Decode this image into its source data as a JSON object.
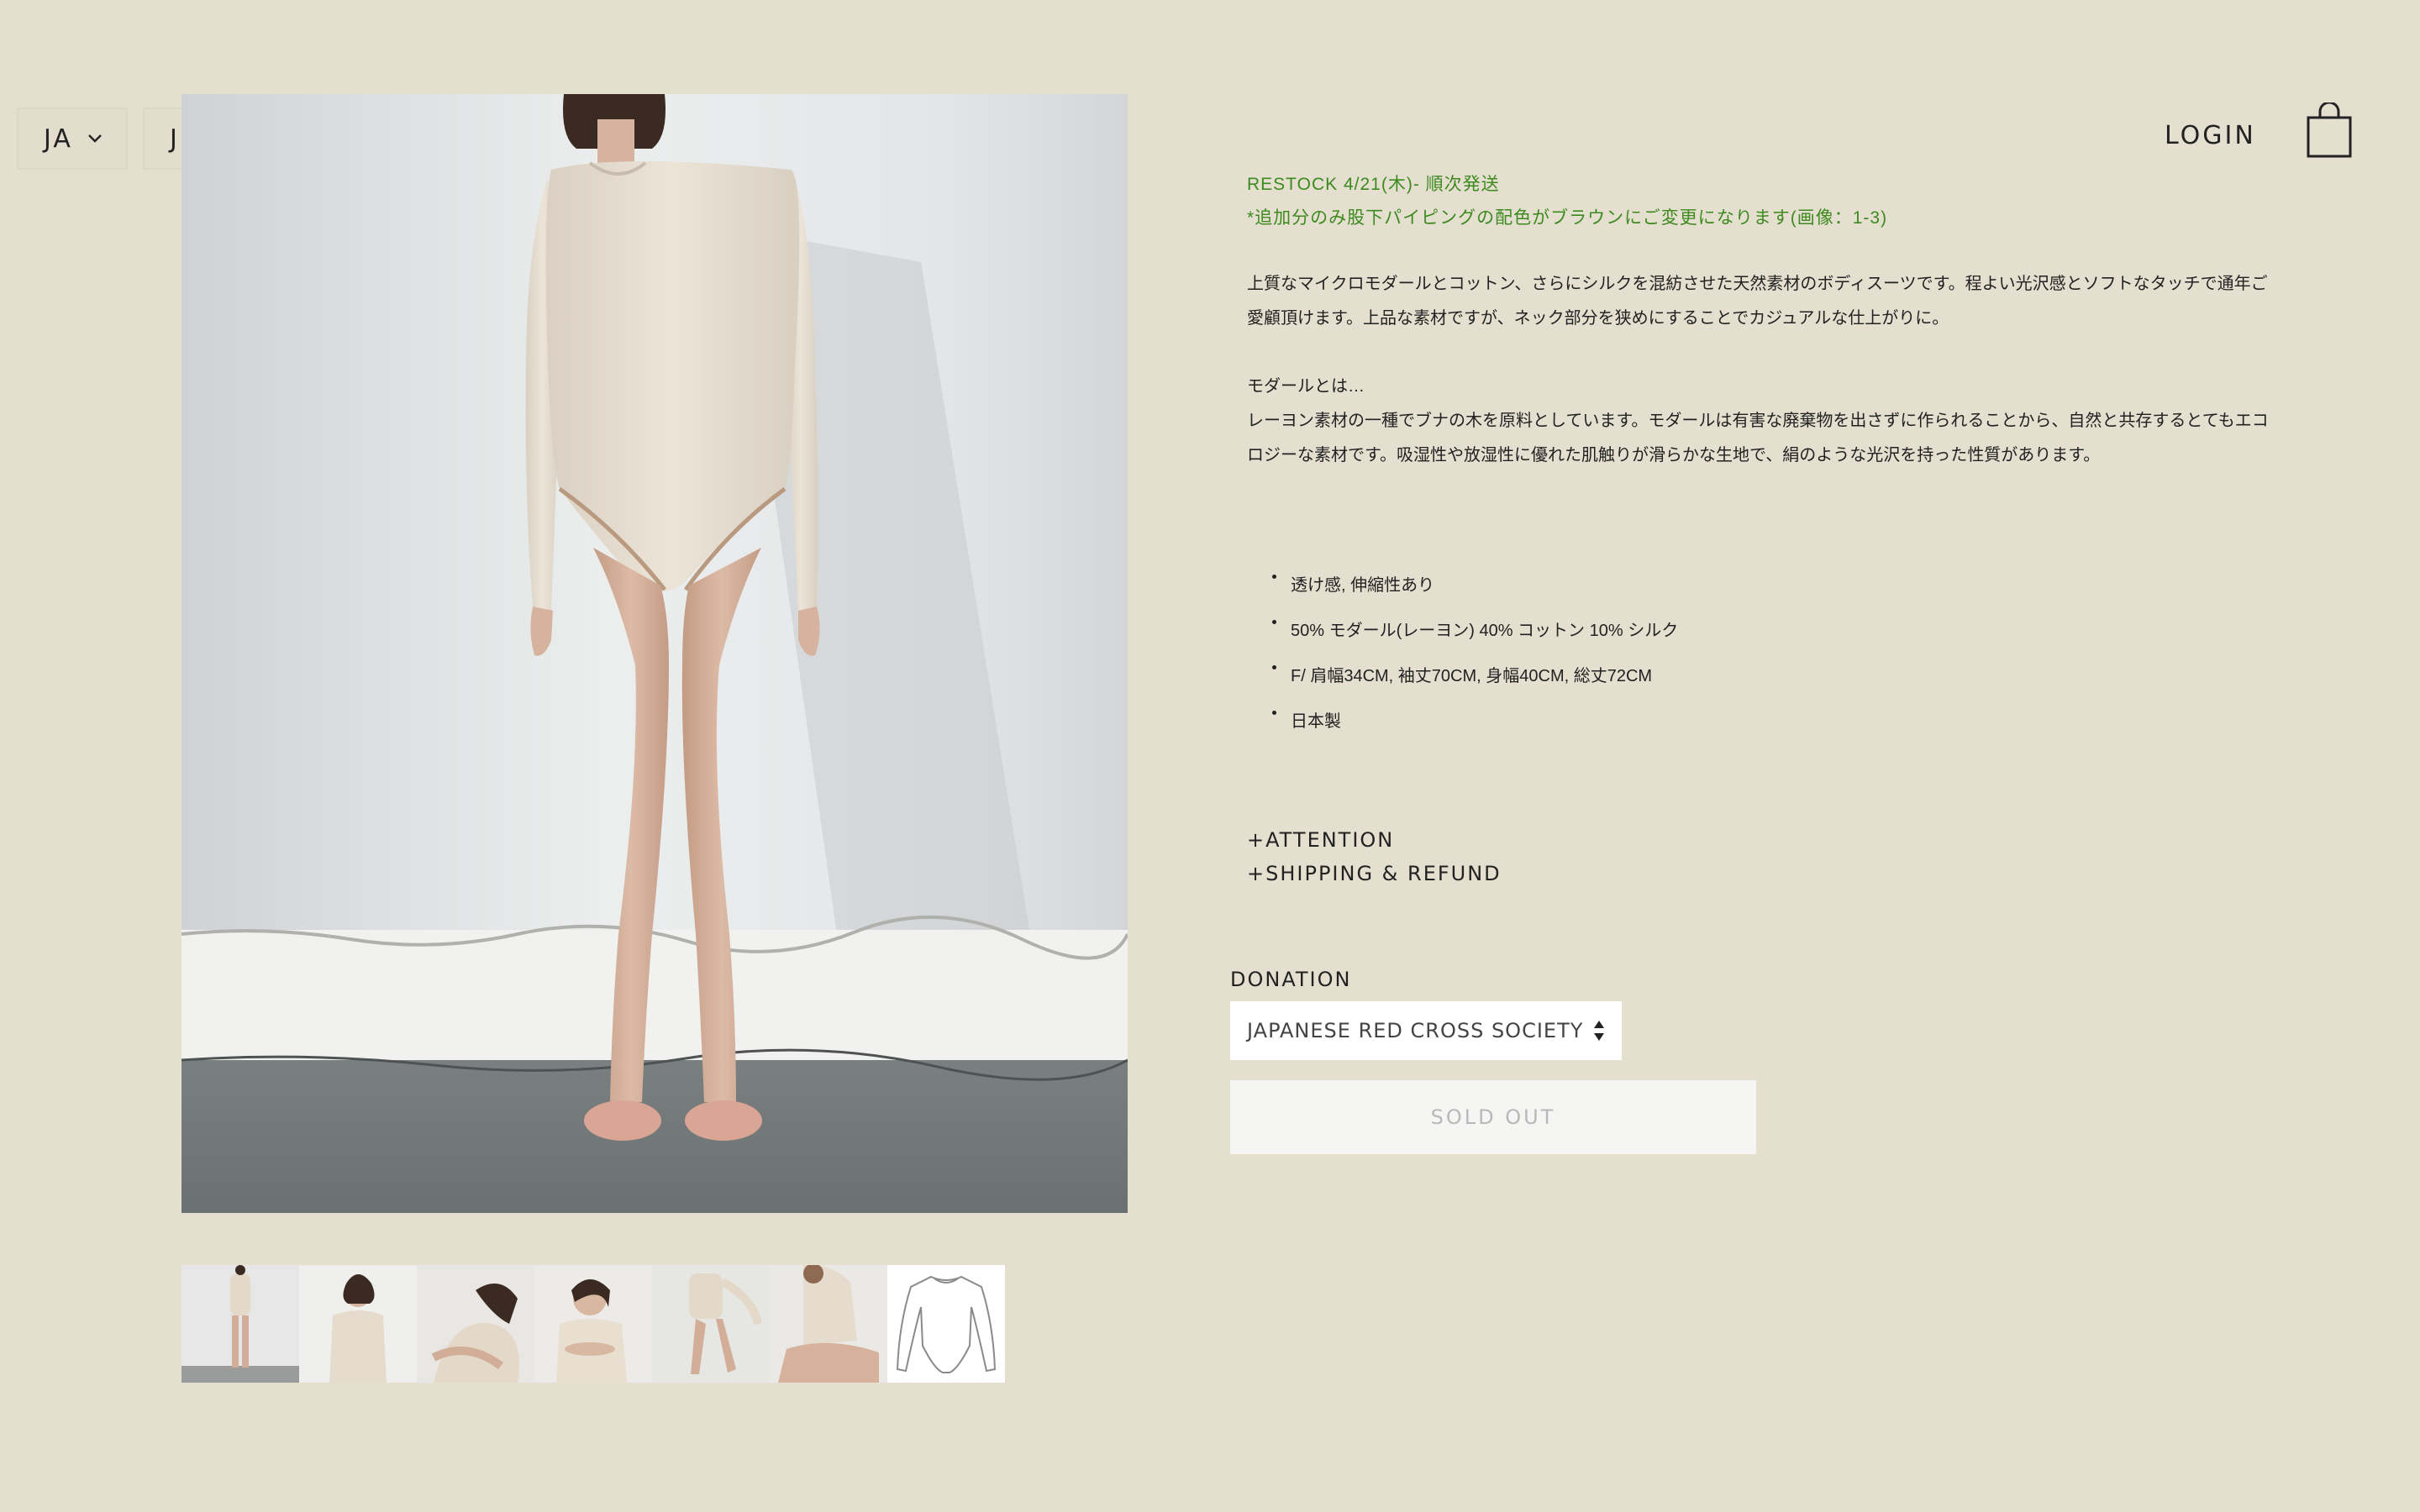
{
  "header": {
    "language": "JA",
    "currency": "JPY",
    "login_label": "LOGIN"
  },
  "product": {
    "restock_line1": "RESTOCK 4/21(木)- 順次発送",
    "restock_line2": "*追加分のみ股下パイピングの配色がブラウンにご変更になります(画像：1-3)",
    "description1": "上質なマイクロモダールとコットン、さらにシルクを混紡させた天然素材のボディスーツです。程よい光沢感とソフトなタッチで通年ご愛顧頂けます。上品な素材ですが、ネック部分を狭めにすることでカジュアルな仕上がりに。",
    "description2_title": "モダールとは…",
    "description2": "レーヨン素材の一種でブナの木を原料としています。モダールは有害な廃棄物を出さずに作られることから、自然と共存するとてもエコロジーな素材です。吸湿性や放湿性に優れた肌触りが滑らかな生地で、絹のような光沢を持った性質があります。",
    "specs": [
      "透け感, 伸縮性あり",
      "50% モダール(レーヨン) 40% コットン 10% シルク",
      "F/ 肩幅34CM, 袖丈70CM, 身幅40CM, 総丈72CM",
      "日本製"
    ],
    "accordion_attention": "+ATTENTION",
    "accordion_shipping": "+SHIPPING & REFUND",
    "donation_label": "DONATION",
    "donation_selected": "JAPANESE RED CROSS SOCIETY",
    "sold_out_label": "SOLD OUT"
  },
  "thumbnails": [
    "thumb-1",
    "thumb-2",
    "thumb-3",
    "thumb-4",
    "thumb-5",
    "thumb-6",
    "thumb-7"
  ],
  "colors": {
    "background": "#e5dfd0",
    "restock_green": "#3d8a1f",
    "text": "#222222",
    "sold_out_bg": "#f5f5f4"
  }
}
